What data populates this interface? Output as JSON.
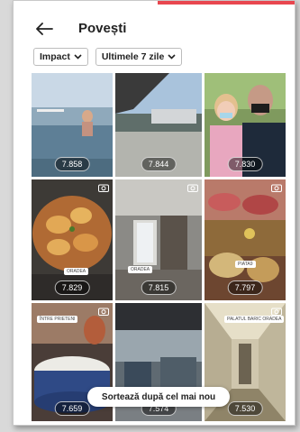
{
  "header": {
    "title": "Povești"
  },
  "filters": [
    {
      "label": "Impact"
    },
    {
      "label": "Ultimele 7 zile"
    }
  ],
  "stories": [
    {
      "views": "7.858",
      "tag": ""
    },
    {
      "views": "7.844",
      "tag": ""
    },
    {
      "views": "7.830",
      "tag": ""
    },
    {
      "views": "7.829",
      "tag": "ORADEA"
    },
    {
      "views": "7.815",
      "tag": "ORADEA"
    },
    {
      "views": "7.797",
      "tag": "PIATA9"
    },
    {
      "views": "7.659",
      "tag": "ÎNTRE PRIETENI"
    },
    {
      "views": "7.574",
      "tag": ""
    },
    {
      "views": "7.530",
      "tag": "PALATUL BARIC ORADEA"
    }
  ],
  "sort_button": {
    "label": "Sortează după cel mai nou"
  },
  "colors": {
    "accent": "#e8474f",
    "text": "#222222"
  }
}
